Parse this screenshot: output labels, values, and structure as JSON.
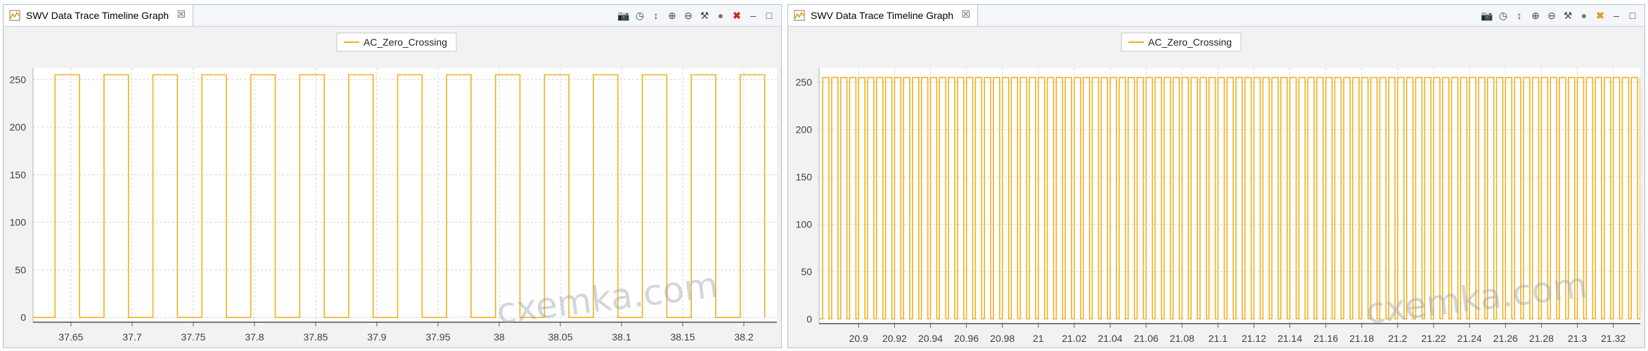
{
  "panels": [
    {
      "id": "left",
      "tab_title": "SWV Data Trace Timeline Graph",
      "legend_label": "AC_Zero_Crossing",
      "watermark": "cxemka.com",
      "toolbar_icons": [
        "camera-icon",
        "clock-icon",
        "scale-icon",
        "zoom-in-icon",
        "zoom-out-icon",
        "tools-icon",
        "stop-circle-icon",
        "delete-x-icon",
        "minimize-icon",
        "maximize-icon"
      ]
    },
    {
      "id": "right",
      "tab_title": "SWV Data Trace Timeline Graph",
      "legend_label": "AC_Zero_Crossing",
      "watermark": "cxemka.com",
      "toolbar_icons": [
        "camera-icon",
        "clock-icon",
        "scale-icon",
        "zoom-in-icon",
        "zoom-out-icon",
        "tools-icon",
        "stop-circle-icon",
        "delete-x-icon",
        "minimize-icon",
        "maximize-icon"
      ]
    }
  ],
  "colors": {
    "trace": "#f0b020",
    "grid": "#d4d4d4",
    "axis_text": "#404040",
    "plot_bg": "#ffffff",
    "delete": "#e02020"
  },
  "chart_data": [
    {
      "type": "line",
      "series": [
        {
          "name": "AC_Zero_Crossing",
          "shape": "square-wave",
          "low": 0,
          "high": 255,
          "rising_edges": [
            37.637,
            37.677,
            37.717,
            37.757,
            37.797,
            37.837,
            37.877,
            37.917,
            37.957,
            37.997,
            38.037,
            38.077,
            38.117,
            38.157,
            38.197
          ],
          "high_duration": 0.02,
          "xmax_visible": 38.227
        }
      ],
      "xlim": [
        37.619,
        38.227
      ],
      "ylim": [
        -5,
        262
      ],
      "x_ticks": [
        "37.65",
        "37.7",
        "37.75",
        "37.8",
        "37.85",
        "37.9",
        "37.95",
        "38",
        "38.05",
        "38.1",
        "38.15",
        "38.2"
      ],
      "y_ticks": [
        "0",
        "50",
        "100",
        "150",
        "200",
        "250"
      ],
      "grid": true,
      "legend_position": "top-center"
    },
    {
      "type": "line",
      "series": [
        {
          "name": "AC_Zero_Crossing",
          "shape": "square-wave",
          "low": 0,
          "high": 255,
          "period": 0.005,
          "high_duration": 0.0035,
          "first_rising": 20.88,
          "xmax_visible": 21.335
        }
      ],
      "xlim": [
        20.878,
        21.335
      ],
      "ylim": [
        -5,
        265
      ],
      "x_ticks": [
        "20.9",
        "20.92",
        "20.94",
        "20.96",
        "20.98",
        "21",
        "21.02",
        "21.04",
        "21.06",
        "21.08",
        "21.1",
        "21.12",
        "21.14",
        "21.16",
        "21.18",
        "21.2",
        "21.22",
        "21.24",
        "21.26",
        "21.28",
        "21.3",
        "21.32"
      ],
      "y_ticks": [
        "0",
        "50",
        "100",
        "150",
        "200",
        "250"
      ],
      "grid": true,
      "legend_position": "top-center"
    }
  ]
}
